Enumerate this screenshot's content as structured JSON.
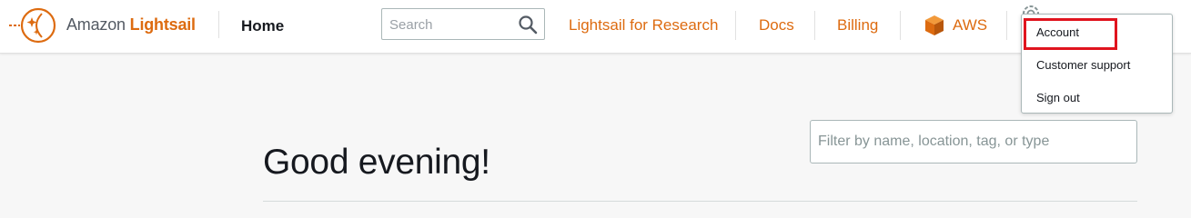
{
  "header": {
    "brand_prefix": "Amazon",
    "brand_name": "Lightsail",
    "home_label": "Home",
    "search_placeholder": "Search",
    "nav": {
      "research": "Lightsail for Research",
      "docs": "Docs",
      "billing": "Billing",
      "aws": "AWS"
    }
  },
  "account_menu": {
    "items": [
      "Account",
      "Customer support",
      "Sign out"
    ],
    "highlighted_item": "Account"
  },
  "main": {
    "greeting": "Good evening!",
    "filter_placeholder": "Filter by name, location, tag, or type"
  },
  "icons": {
    "logo": "lightsail-logo-icon",
    "search": "search-icon",
    "aws": "aws-cube-icon",
    "settings": "gear-icon"
  },
  "colors": {
    "accent": "#dd6b10",
    "text": "#16191f",
    "highlight": "#e0141e"
  }
}
